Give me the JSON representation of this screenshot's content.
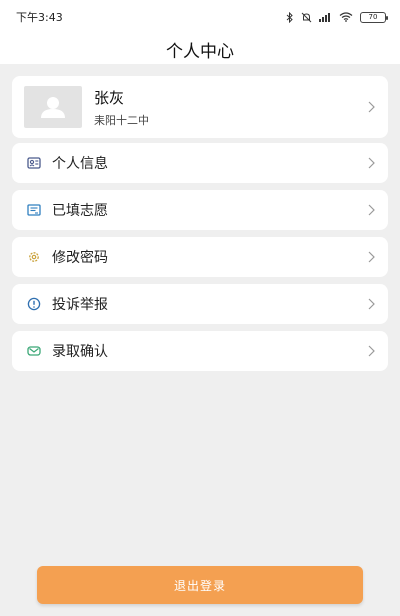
{
  "status_bar": {
    "time": "下午3:43",
    "battery": "70"
  },
  "header": {
    "title": "个人中心"
  },
  "profile": {
    "name": "张灰",
    "school": "耒阳十二中"
  },
  "menu": {
    "items": [
      {
        "label": "个人信息",
        "icon": "id-card-icon",
        "color": "#4a5a8c"
      },
      {
        "label": "已填志愿",
        "icon": "form-icon",
        "color": "#2f7fbf"
      },
      {
        "label": "修改密码",
        "icon": "gear-icon",
        "color": "#c9a13a"
      },
      {
        "label": "投诉举报",
        "icon": "alert-icon",
        "color": "#2f6fb0"
      },
      {
        "label": "录取确认",
        "icon": "envelope-icon",
        "color": "#3aa776"
      }
    ]
  },
  "logout": {
    "label": "退出登录",
    "color": "#f4a051"
  }
}
